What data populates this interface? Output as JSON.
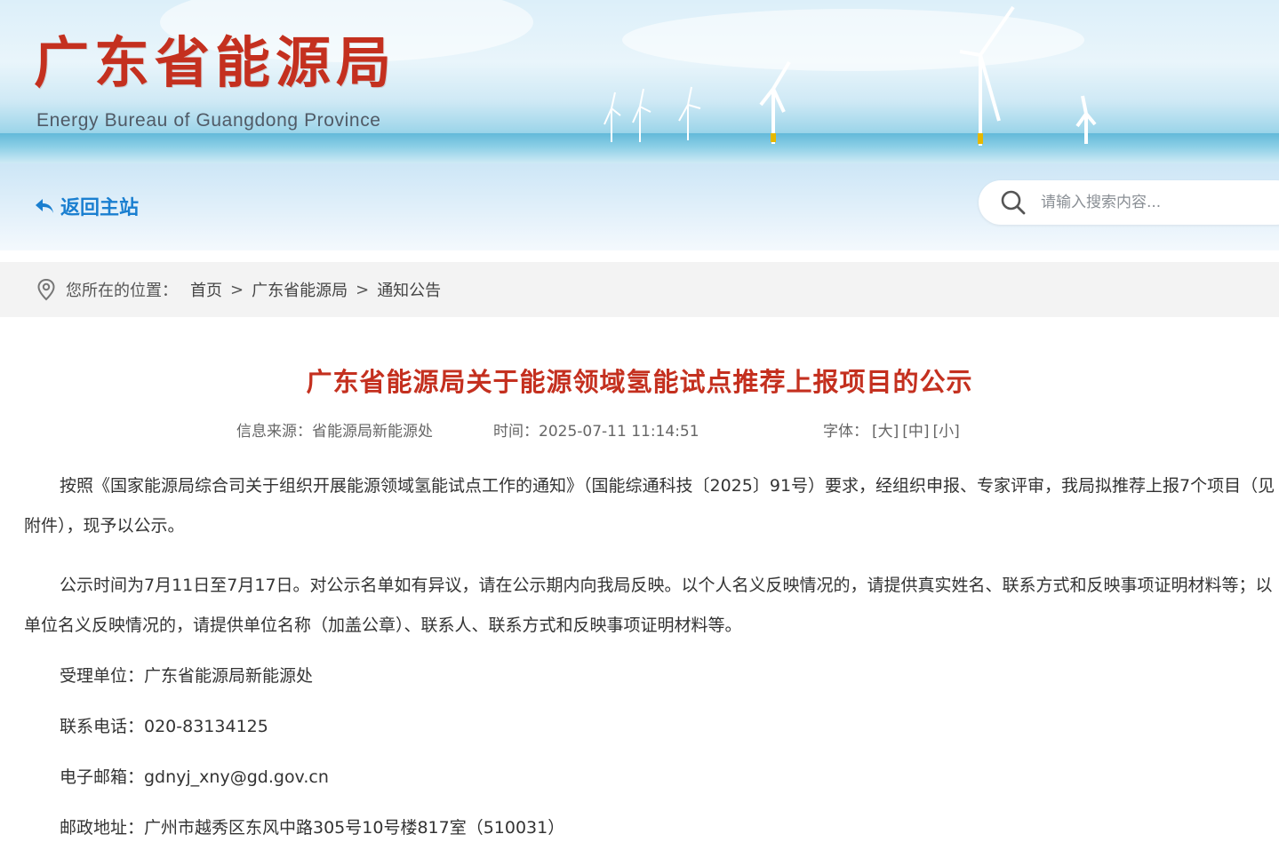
{
  "header": {
    "site_title": "广东省能源局",
    "site_subtitle": "Energy Bureau of Guangdong Province"
  },
  "nav": {
    "back_label": "返回主站",
    "search_placeholder": "请输入搜索内容..."
  },
  "breadcrumb": {
    "prefix": "您所在的位置：",
    "items": [
      "首页",
      "广东省能源局",
      "通知公告"
    ],
    "separator": ">"
  },
  "article": {
    "title": "广东省能源局关于能源领域氢能试点推荐上报项目的公示",
    "source_label": "信息来源：",
    "source": "省能源局新能源处",
    "time_label": "时间：",
    "time": "2025-07-11 11:14:51",
    "font_label": "字体：",
    "font_large": "[大]",
    "font_medium": "[中]",
    "font_small": "[小]",
    "paragraphs": [
      "按照《国家能源局综合司关于组织开展能源领域氢能试点工作的通知》（国能综通科技〔2025〕91号）要求，经组织申报、专家评审，我局拟推荐上报7个项目（见附件），现予以公示。",
      "公示时间为7月11日至7月17日。对公示名单如有异议，请在公示期内向我局反映。以个人名义反映情况的，请提供真实姓名、联系方式和反映事项证明材料等；以单位名义反映情况的，请提供单位名称（加盖公章）、联系人、联系方式和反映事项证明材料等。"
    ],
    "contact_unit": "受理单位：广东省能源局新能源处",
    "contact_phone": "联系电话：020-83134125",
    "contact_email": "电子邮箱：gdnyj_xny@gd.gov.cn",
    "contact_address": "邮政地址：广州市越秀区东风中路305号10号楼817室（510031）"
  },
  "colors": {
    "title_red": "#c4301f",
    "link_blue": "#1a7fd0",
    "breadcrumb_bg": "#f3f3f3"
  }
}
